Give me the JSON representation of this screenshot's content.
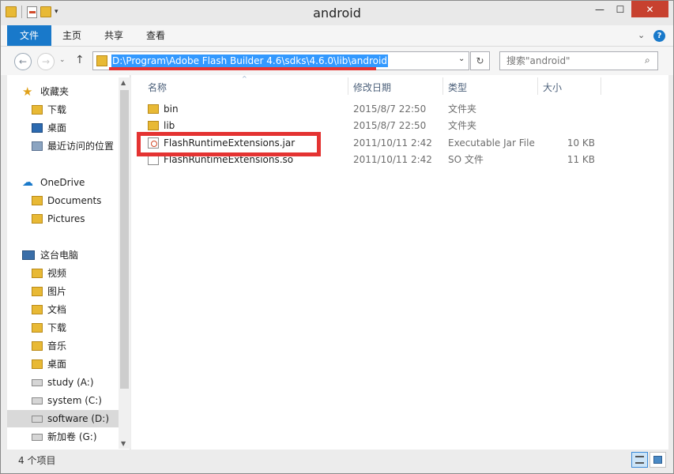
{
  "window": {
    "title": "android",
    "controls": {
      "minimize": "—",
      "maximize": "☐",
      "close": "✕"
    },
    "qat_dropdown": "▾"
  },
  "ribbon": {
    "tabs": [
      "文件",
      "主页",
      "共享",
      "查看"
    ],
    "expand": "⌄",
    "help": "?"
  },
  "address": {
    "path": "D:\\Program\\Adobe Flash Builder 4.6\\sdks\\4.6.0\\lib\\android",
    "dropdown": "⌄",
    "refresh": "↻",
    "back": "←",
    "forward": "→",
    "history": "⌄",
    "up": "↑"
  },
  "search": {
    "placeholder": "搜索\"android\"",
    "icon": "⌕"
  },
  "nav": {
    "favorites": {
      "label": "收藏夹",
      "items": [
        "下载",
        "桌面",
        "最近访问的位置"
      ]
    },
    "onedrive": {
      "label": "OneDrive",
      "items": [
        "Documents",
        "Pictures"
      ]
    },
    "thispc": {
      "label": "这台电脑",
      "items": [
        "视频",
        "图片",
        "文档",
        "下载",
        "音乐",
        "桌面"
      ]
    },
    "drives": [
      "study (A:)",
      "system (C:)",
      "software (D:)",
      "新加卷 (G:)"
    ],
    "selected_drive": "software (D:)"
  },
  "list": {
    "sort_indicator": "^",
    "columns": [
      "名称",
      "修改日期",
      "类型",
      "大小"
    ],
    "rows": [
      {
        "name": "bin",
        "date": "2015/8/7 22:50",
        "type": "文件夹",
        "size": "",
        "icon": "folder-icon"
      },
      {
        "name": "lib",
        "date": "2015/8/7 22:50",
        "type": "文件夹",
        "size": "",
        "icon": "folder-icon"
      },
      {
        "name": "FlashRuntimeExtensions.jar",
        "date": "2011/10/11 2:42",
        "type": "Executable Jar File",
        "size": "10 KB",
        "icon": "java-jar-icon"
      },
      {
        "name": "FlashRuntimeExtensions.so",
        "date": "2011/10/11 2:42",
        "type": "SO 文件",
        "size": "11 KB",
        "icon": "blank-file-icon"
      }
    ]
  },
  "status": {
    "item_count": "4 个项目"
  },
  "colors": {
    "accent": "#1979ca",
    "highlight_red": "#e43332",
    "selection": "#3399ff"
  }
}
